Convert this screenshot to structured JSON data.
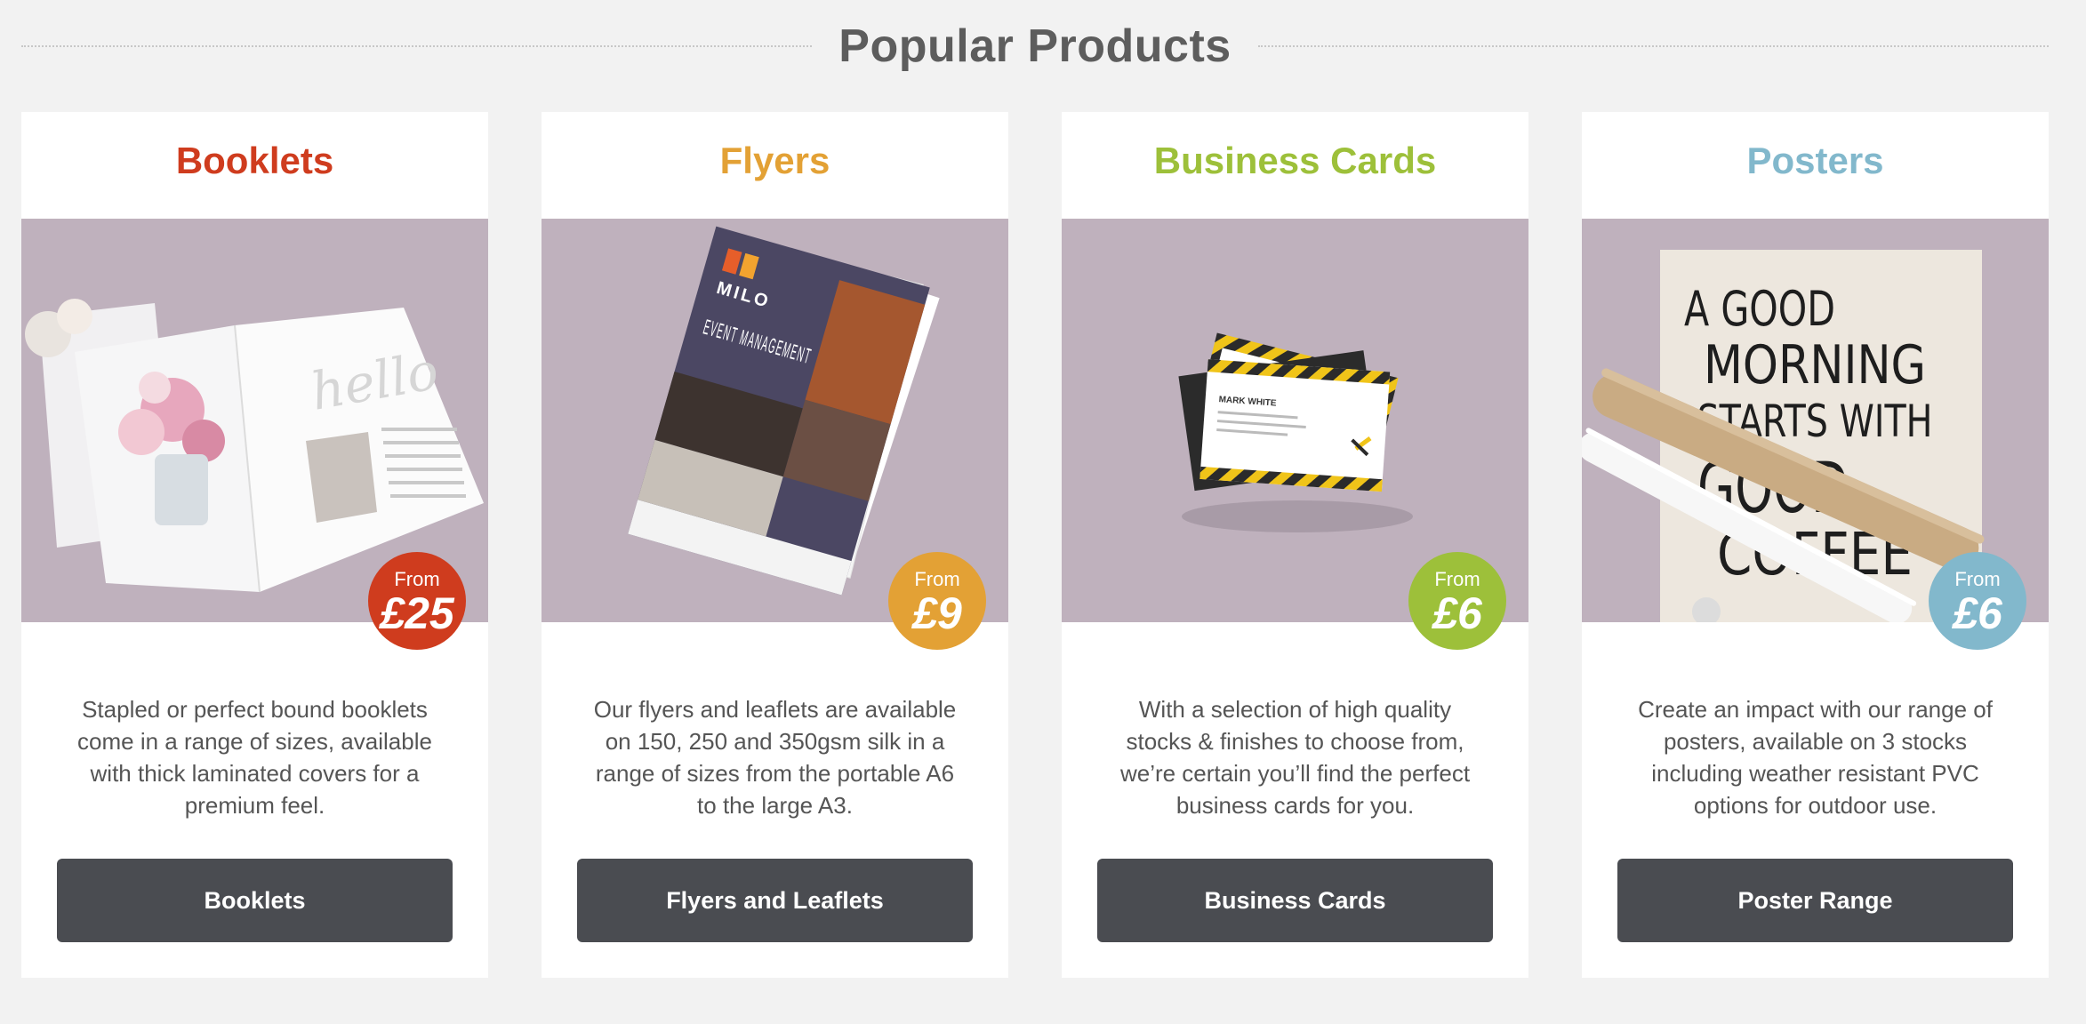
{
  "section": {
    "title": "Popular Products"
  },
  "products": [
    {
      "title": "Booklets",
      "color": "#cf3c1e",
      "price_from": "From",
      "price": "£25",
      "description": "Stapled or perfect bound booklets come in a range of sizes, available with thick laminated covers for a premium feel.",
      "button": "Booklets",
      "image_text": "hello"
    },
    {
      "title": "Flyers",
      "color": "#e3a135",
      "price_from": "From",
      "price": "£9",
      "description": "Our flyers and leaflets are available on 150, 250 and 350gsm silk in a range of sizes from the portable A6 to the large A3.",
      "button": "Flyers and Leaflets",
      "image_brand": "MILO",
      "image_heading": "EVENT MANAGEMENT"
    },
    {
      "title": "Business Cards",
      "color": "#9dc03a",
      "price_from": "From",
      "price": "£6",
      "description": "With a selection of high quality stocks & finishes to choose from, we’re certain you’ll find the perfect business cards for you.",
      "button": "Business Cards",
      "image_name": "MARK WHITE"
    },
    {
      "title": "Posters",
      "color": "#82b8cc",
      "price_from": "From",
      "price": "£6",
      "description": "Create an impact with our range of posters, available on 3 stocks including weather resistant PVC options for outdoor use.",
      "button": "Poster Range",
      "image_lines": [
        "A GOOD",
        "MORNING",
        "STARTS WITH",
        "GOOD",
        "COFFEE"
      ]
    }
  ]
}
